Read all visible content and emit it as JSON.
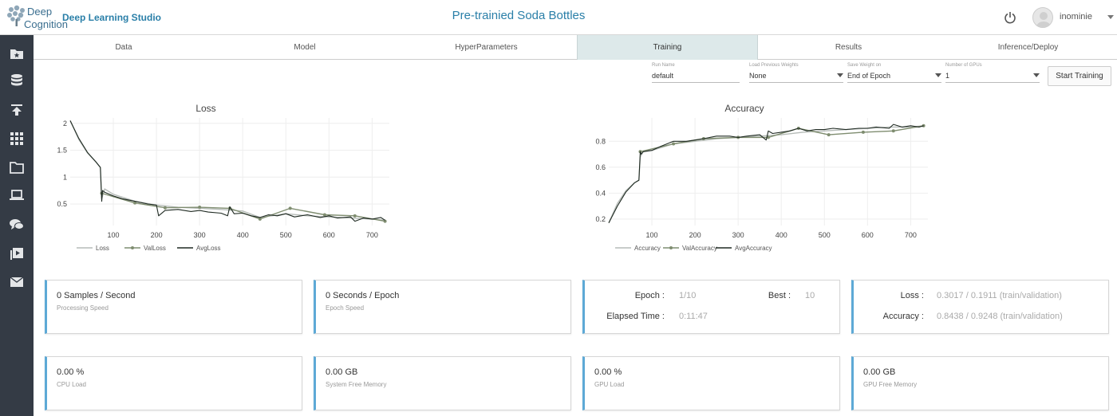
{
  "header": {
    "logo_line1": "Deep",
    "logo_line2": "Cognition",
    "app_name": "Deep Learning Studio",
    "project_title": "Pre-trainied Soda Bottles",
    "username": "inominie",
    "power_icon": "power-icon"
  },
  "sidebar": {
    "items": [
      {
        "name": "folder-star-icon"
      },
      {
        "name": "database-icon"
      },
      {
        "name": "upload-icon"
      },
      {
        "name": "grid-icon"
      },
      {
        "name": "folder-icon"
      },
      {
        "name": "laptop-icon"
      },
      {
        "name": "chat-icon"
      },
      {
        "name": "video-icon"
      },
      {
        "name": "mail-icon"
      }
    ]
  },
  "tabs": [
    "Data",
    "Model",
    "HyperParameters",
    "Training",
    "Results",
    "Inference/Deploy"
  ],
  "active_tab": "Training",
  "training_params": {
    "run_name": {
      "label": "Run Name",
      "value": "default"
    },
    "load_weights": {
      "label": "Load Previous Weights",
      "value": "None"
    },
    "save_weight": {
      "label": "Save Weight on",
      "value": "End of Epoch"
    },
    "gpus": {
      "label": "Number of GPUs",
      "value": "1"
    },
    "start_button": "Start Training"
  },
  "colors": {
    "accent": "#2a7fa8",
    "sidebar_bg": "#343b45",
    "card_border": "#5da9d6",
    "series_loss": "#b6bcb8",
    "series_val": "#7f8d70",
    "series_avg": "#1f2a22"
  },
  "chart_data": [
    {
      "type": "line",
      "title": "Loss",
      "xlabel": "",
      "ylabel": "",
      "xlim": [
        0,
        740
      ],
      "ylim": [
        0.1,
        2.1
      ],
      "xticks": [
        100,
        200,
        300,
        400,
        500,
        600,
        700
      ],
      "yticks": [
        0.5,
        1,
        1.5,
        2
      ],
      "ytick_labels": [
        "0.5",
        "1",
        "1.5",
        "2"
      ],
      "grid": true,
      "legend_position": "bottom",
      "series": [
        {
          "name": "Loss",
          "x": [
            0,
            20,
            40,
            60,
            70,
            73,
            80,
            100,
            150,
            200,
            250,
            300,
            350,
            400,
            440,
            500,
            550,
            600,
            650,
            700,
            730
          ],
          "y": [
            2.05,
            1.7,
            1.45,
            1.28,
            1.18,
            0.6,
            0.78,
            0.68,
            0.55,
            0.48,
            0.44,
            0.42,
            0.4,
            0.37,
            0.25,
            0.32,
            0.28,
            0.26,
            0.24,
            0.22,
            0.2
          ]
        },
        {
          "name": "ValLoss",
          "x": [
            73,
            150,
            220,
            300,
            370,
            440,
            510,
            590,
            660,
            730
          ],
          "y": [
            0.7,
            0.52,
            0.43,
            0.44,
            0.42,
            0.22,
            0.42,
            0.3,
            0.28,
            0.18
          ]
        },
        {
          "name": "AvgLoss",
          "x": [
            0,
            20,
            40,
            60,
            70,
            73,
            75,
            80,
            100,
            120,
            150,
            180,
            200,
            205,
            220,
            250,
            280,
            300,
            320,
            350,
            365,
            370,
            380,
            400,
            420,
            440,
            460,
            480,
            500,
            520,
            550,
            580,
            600,
            620,
            650,
            660,
            680,
            700,
            720,
            730
          ],
          "y": [
            2.05,
            1.72,
            1.46,
            1.28,
            1.18,
            0.55,
            0.75,
            0.72,
            0.65,
            0.6,
            0.55,
            0.5,
            0.48,
            0.28,
            0.38,
            0.4,
            0.36,
            0.38,
            0.35,
            0.33,
            0.28,
            0.45,
            0.32,
            0.33,
            0.28,
            0.25,
            0.3,
            0.28,
            0.32,
            0.26,
            0.3,
            0.25,
            0.28,
            0.24,
            0.26,
            0.18,
            0.24,
            0.22,
            0.25,
            0.2
          ]
        }
      ]
    },
    {
      "type": "line",
      "title": "Accuracy",
      "xlabel": "",
      "ylabel": "",
      "xlim": [
        0,
        740
      ],
      "ylim": [
        0.15,
        0.98
      ],
      "xticks": [
        100,
        200,
        300,
        400,
        500,
        600,
        700
      ],
      "yticks": [
        0.2,
        0.4,
        0.6,
        0.8
      ],
      "ytick_labels": [
        "0.2",
        "0.4",
        "0.6",
        "0.8"
      ],
      "grid": true,
      "legend_position": "bottom",
      "series": [
        {
          "name": "Accuracy",
          "x": [
            0,
            20,
            40,
            60,
            70,
            73,
            80,
            100,
            150,
            200,
            250,
            300,
            350,
            400,
            450,
            500,
            550,
            600,
            650,
            700,
            730
          ],
          "y": [
            0.17,
            0.32,
            0.42,
            0.48,
            0.5,
            0.68,
            0.72,
            0.73,
            0.78,
            0.8,
            0.82,
            0.83,
            0.84,
            0.85,
            0.87,
            0.88,
            0.89,
            0.9,
            0.91,
            0.91,
            0.92
          ]
        },
        {
          "name": "ValAccuracy",
          "x": [
            73,
            150,
            220,
            300,
            370,
            440,
            510,
            590,
            660,
            730
          ],
          "y": [
            0.72,
            0.78,
            0.82,
            0.83,
            0.83,
            0.9,
            0.85,
            0.87,
            0.88,
            0.92
          ]
        },
        {
          "name": "AvgAccuracy",
          "x": [
            0,
            20,
            40,
            60,
            70,
            73,
            75,
            80,
            100,
            120,
            150,
            180,
            200,
            220,
            250,
            280,
            300,
            320,
            350,
            365,
            370,
            380,
            400,
            420,
            440,
            460,
            480,
            500,
            520,
            550,
            580,
            600,
            620,
            650,
            660,
            680,
            700,
            720,
            730
          ],
          "y": [
            0.17,
            0.3,
            0.41,
            0.48,
            0.5,
            0.72,
            0.7,
            0.72,
            0.73,
            0.76,
            0.8,
            0.8,
            0.81,
            0.82,
            0.84,
            0.84,
            0.83,
            0.84,
            0.85,
            0.81,
            0.88,
            0.86,
            0.87,
            0.88,
            0.9,
            0.88,
            0.89,
            0.89,
            0.9,
            0.89,
            0.9,
            0.9,
            0.91,
            0.9,
            0.93,
            0.91,
            0.92,
            0.91,
            0.92
          ]
        }
      ]
    }
  ],
  "stats": {
    "processing": {
      "value": "0 Samples / Second",
      "label": "Processing Speed"
    },
    "epoch_speed": {
      "value": "0 Seconds / Epoch",
      "label": "Epoch Speed"
    },
    "epoch": {
      "label": "Epoch :",
      "value": "1/10"
    },
    "best": {
      "label": "Best :",
      "value": "10"
    },
    "elapsed": {
      "label": "Elapsed Time :",
      "value": "0:11:47"
    },
    "loss": {
      "label": "Loss :",
      "value": "0.3017 / 0.1911 (train/validation)"
    },
    "accuracy": {
      "label": "Accuracy :",
      "value": "0.8438 / 0.9248 (train/validation)"
    },
    "cpu": {
      "value": "0.00 %",
      "label": "CPU Load"
    },
    "sys_mem": {
      "value": "0.00 GB",
      "label": "System Free Memory"
    },
    "gpu": {
      "value": "0.00 %",
      "label": "GPU Load"
    },
    "gpu_mem": {
      "value": "0.00 GB",
      "label": "GPU Free Memory"
    }
  }
}
